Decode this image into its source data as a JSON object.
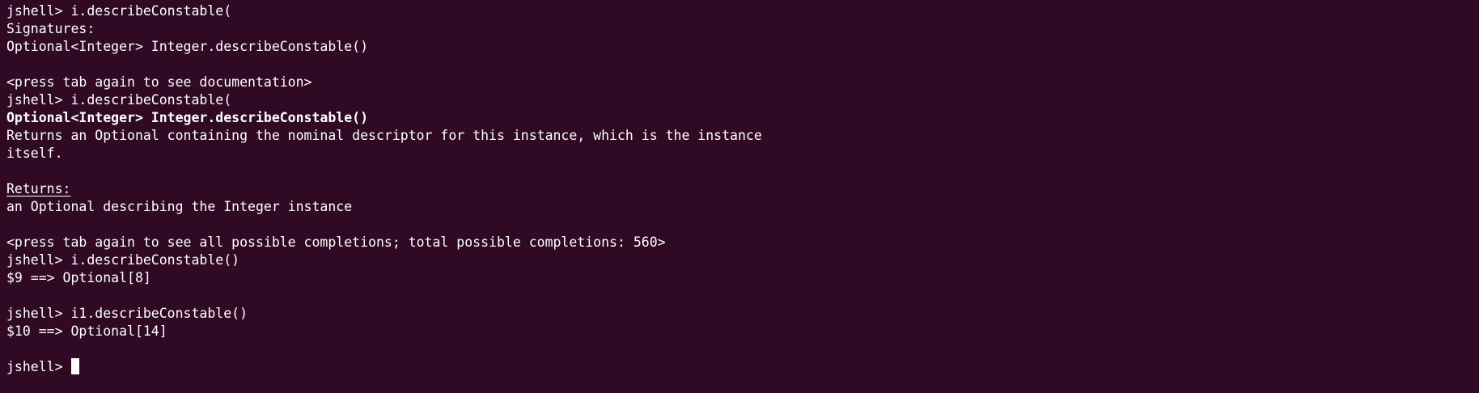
{
  "terminal": {
    "lines": [
      "jshell> i.describeConstable(",
      "Signatures:",
      "Optional<Integer> Integer.describeConstable()",
      "",
      "<press tab again to see documentation>",
      "jshell> i.describeConstable(",
      "Optional<Integer> Integer.describeConstable()",
      "Returns an Optional containing the nominal descriptor for this instance, which is the instance",
      "itself.",
      "",
      "Returns:",
      "an Optional describing the Integer instance",
      "",
      "<press tab again to see all possible completions; total possible completions: 560>",
      "jshell> i.describeConstable()",
      "$9 ==> Optional[8]",
      "",
      "jshell> i1.describeConstable()",
      "$10 ==> Optional[14]",
      "",
      "jshell> "
    ],
    "colors": {
      "background": "#300a24",
      "foreground": "#ffffff"
    }
  }
}
